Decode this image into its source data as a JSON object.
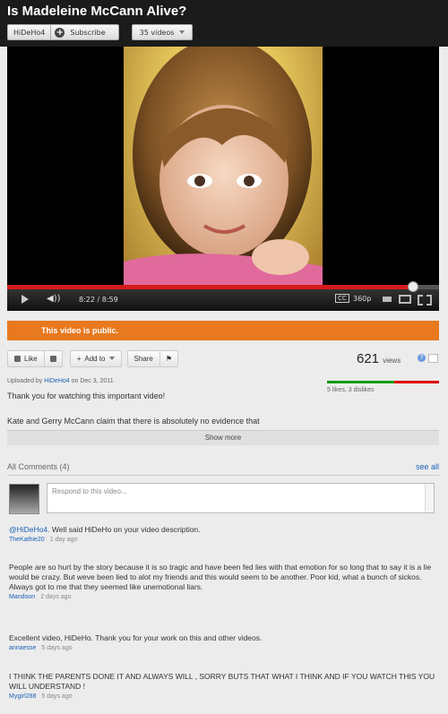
{
  "video": {
    "title": "Is Madeleine McCann Alive?",
    "channel": "HiDeHo4",
    "subscribe": "Subscribe",
    "videos_count": "35 videos",
    "time": "8:22 / 8:59",
    "cc": "CC",
    "quality": "360p",
    "progress_fraction": 0.94
  },
  "status_banner": "This video is public.",
  "actions": {
    "like": "Like",
    "add_to": "Add to",
    "share": "Share"
  },
  "stats": {
    "views_count": "621",
    "views_label": "views",
    "likes": "5 likes, 3 dislikes",
    "like_fraction": 0.6
  },
  "description": {
    "uploaded_prefix": "Uploaded by",
    "uploader": "HiDeHo4",
    "uploaded_suffix": "on Dec 3, 2011",
    "thanks": "Thank you for watching this important video!",
    "body": "Kate and Gerry McCann claim that there is absolutely no evidence that",
    "show_more": "Show more"
  },
  "comments": {
    "header": "All Comments (4)",
    "see_all": "see all",
    "placeholder": "Respond to this video...",
    "items": [
      {
        "mention": "@HiDeHo4.",
        "text": " Well said HiDeHo on your video description.",
        "user": "TheKathie20",
        "time": "1 day ago"
      },
      {
        "mention": "",
        "text": "People are so hurt by the story because it is so tragic and have been fed lies with that emotion for so long that to say it is a lie would be crazy. But weve been lied to alot my friends and this would seem to be another. Poor kid, what a bunch of sickos. Always got to me that they seemed like unemotional liars.",
        "user": "Mandoon",
        "time": "2 days ago"
      },
      {
        "mention": "",
        "text": "Excellent video, HiDeHo. Thank you for your work on this and other videos.",
        "user": "annaesse",
        "time": "5 days ago"
      },
      {
        "mention": "",
        "text": "I THINK THE PARENTS DONE IT AND ALWAYS WILL , SORRY BUTS THAT WHAT I THINK AND IF YOU WATCH THIS YOU WILL UNDERSTAND !",
        "user": "Mygirl288",
        "time": "5 days ago"
      }
    ]
  }
}
